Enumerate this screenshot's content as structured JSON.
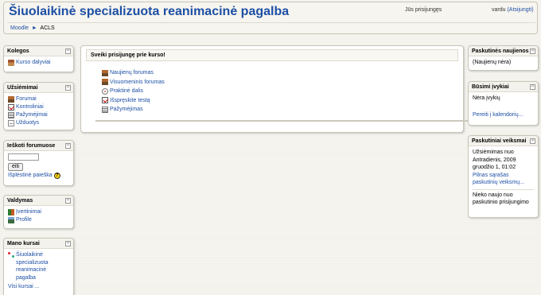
{
  "header": {
    "site_title": "Šiuolaikinė specializuota reanimacinė pagalba",
    "login_status": "Jūs prisijungęs",
    "user_name": "vardu",
    "logout_label": "(Atsijungti)"
  },
  "breadcrumb": {
    "home": "Moodle",
    "separator": "►",
    "current": "ACLS"
  },
  "toggle_symbol": "−",
  "left": {
    "kolegos": {
      "title": "Kolegos",
      "items": [
        {
          "label": "Kurso dalyviai",
          "icon": "people-icon"
        }
      ]
    },
    "uzsiemimai": {
      "title": "Užsiėmimai",
      "items": [
        {
          "label": "Forumai",
          "icon": "forum-icon"
        },
        {
          "label": "Kontroliniai",
          "icon": "quiz-icon"
        },
        {
          "label": "Pažymėjimai",
          "icon": "grades-icon"
        },
        {
          "label": "Užduotys",
          "icon": "assignment-icon"
        }
      ]
    },
    "search": {
      "title": "Ieškoti forumuose",
      "input_value": "",
      "button_label": "eiti",
      "advanced_label": "Išplėstinė paieška"
    },
    "valdymas": {
      "title": "Valdymas",
      "items": [
        {
          "label": "Įvertinimai",
          "icon": "grades-book-icon"
        },
        {
          "label": "Profile",
          "icon": "user-icon"
        }
      ]
    },
    "mano_kursai": {
      "title": "Mano kursai",
      "course_lines": [
        "Šiuolaikinė",
        "specializuota",
        "reanimacinė",
        "pagalba"
      ],
      "all_courses": "Visi kursai ..."
    }
  },
  "center": {
    "title": "Sveiki prisijungę prie kurso!",
    "items": [
      {
        "label": "Naujienų forumas",
        "icon": "forum-icon"
      },
      {
        "label": "Visuomeninis forumas",
        "icon": "forum-icon"
      },
      {
        "label": "Praktinė dalis",
        "icon": "resource-icon"
      },
      {
        "label": "Išspręskite testą",
        "icon": "quiz-icon"
      },
      {
        "label": "Pažymėjimas",
        "icon": "grades-icon"
      }
    ]
  },
  "right": {
    "news": {
      "title": "Paskutinės naujienos",
      "empty": "(Naujienų nėra)"
    },
    "events": {
      "title": "Būsimi įvykiai",
      "empty": "Nėra įvykių",
      "calendar_link": "Pereiti į kalendorių..."
    },
    "activity": {
      "title": "Paskutiniai veiksmai",
      "since_lines": [
        "Užsiėmimas nuo",
        "Antradienis, 2009",
        "gruodžio 1, 01:02"
      ],
      "full_report_lines": [
        "Pilnas sąrašas",
        "paskutinių veiksmų..."
      ],
      "nothing_lines": [
        "Nieko naujo nuo",
        "paskutinio prisijungimo"
      ]
    }
  }
}
